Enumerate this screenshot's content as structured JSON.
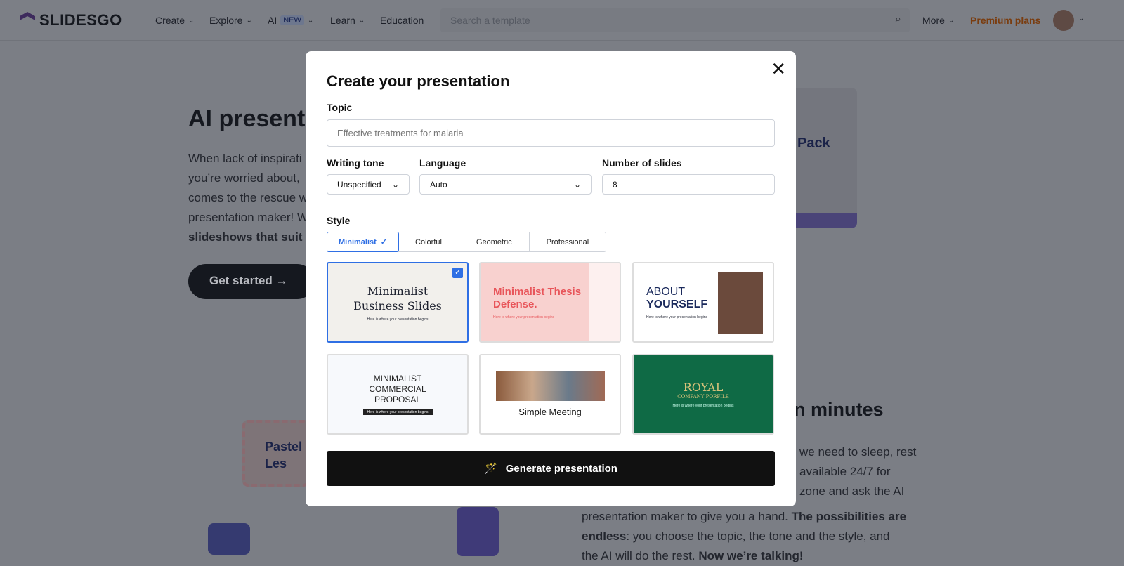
{
  "nav": {
    "logo": "SLIDESGO",
    "items": [
      {
        "label": "Create"
      },
      {
        "label": "Explore"
      },
      {
        "label": "AI",
        "badge": "NEW"
      },
      {
        "label": "Learn"
      },
      {
        "label": "Education"
      }
    ],
    "search_placeholder": "Search a template",
    "more": "More",
    "premium": "Premium plans"
  },
  "background": {
    "hero_title": "AI present",
    "hero_lines": [
      "When lack of inspirati",
      "you’re worried about, ",
      "comes to the rescue w",
      "presentation maker! W"
    ],
    "hero_bold": "slideshows that suit y",
    "get_started": "Get started",
    "section_title": "n minutes",
    "section_lines": [
      "we need to sleep, rest",
      "available 24/7 for",
      "zone and ask the AI"
    ],
    "section_line4": "presentation maker to give you a hand. ",
    "section_line4_bold": "The possibilities are",
    "section_line5_bold": "endless",
    "section_line5": ": you choose the topic, the tone and the style, and",
    "section_line6": "the AI will do the rest. ",
    "section_line6_bold": "Now we’re talking!",
    "illus_left": "Pastel Les",
    "illus_right": "Pack"
  },
  "modal": {
    "title": "Create your presentation",
    "topic_label": "Topic",
    "topic_value": "Effective treatments for malaria",
    "tone_label": "Writing tone",
    "tone_value": "Unspecified",
    "language_label": "Language",
    "language_value": "Auto",
    "slides_label": "Number of slides",
    "slides_value": "8",
    "style_label": "Style",
    "style_tabs": [
      "Minimalist",
      "Colorful",
      "Geometric",
      "Professional"
    ],
    "active_style": "Minimalist",
    "templates": [
      {
        "title": "Minimalist Business Slides",
        "subtitle": "Here is where your presentation begins",
        "selected": true
      },
      {
        "title": "Minimalist Thesis Defense.",
        "subtitle": "Here is where your presentation begins"
      },
      {
        "title1": "ABOUT",
        "title2": "YOURSELF",
        "subtitle": "Here is where your presentation begins"
      },
      {
        "title": "MINIMALIST COMMERCIAL PROPOSAL",
        "subtitle": "Here is where your presentation begins"
      },
      {
        "title": "Simple Meeting"
      },
      {
        "title": "ROYAL",
        "title2": "COMPANY PORFILE",
        "subtitle": "Here is where your presentation begins"
      }
    ],
    "generate": "Generate presentation"
  },
  "colors": {
    "accent": "#2f6fe4",
    "premium": "#e0742a",
    "button": "#111111"
  }
}
